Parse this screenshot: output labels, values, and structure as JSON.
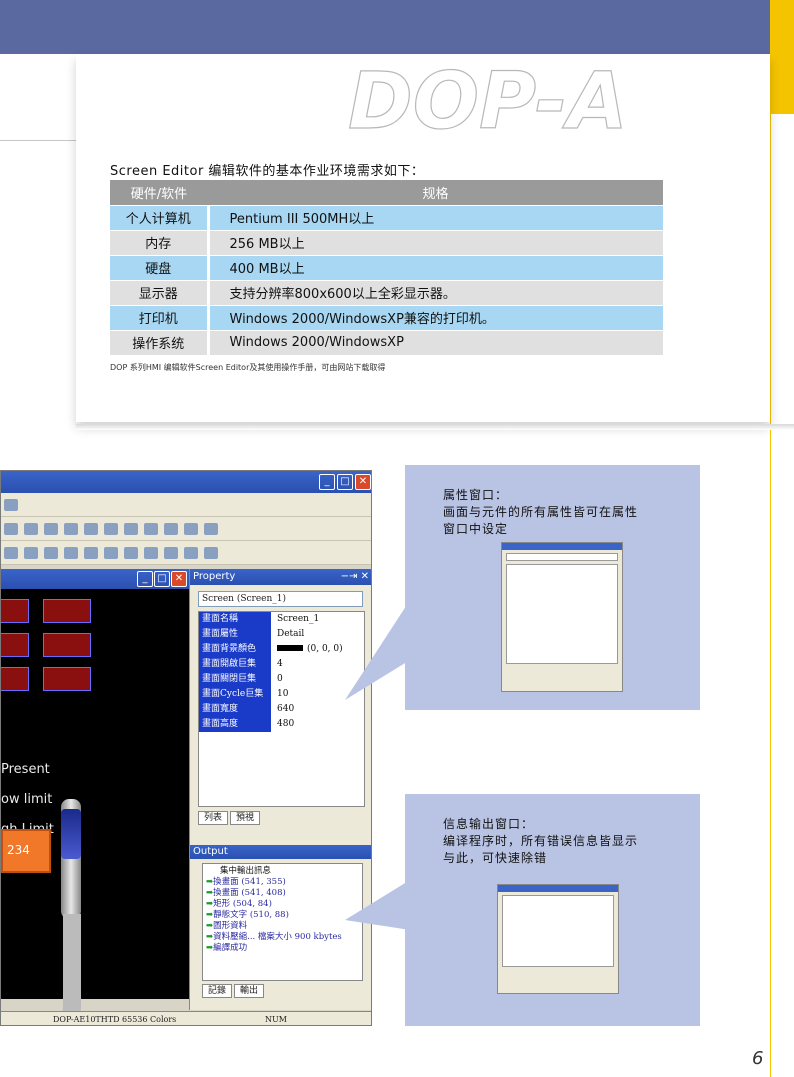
{
  "logo_text": "DOP-A",
  "intro": "Screen Editor 编辑软件的基本作业环境需求如下：",
  "table": {
    "headers": [
      "硬件/软件",
      "规格"
    ],
    "rows": [
      {
        "k": "个人计算机",
        "v": "Pentium III 500MH以上"
      },
      {
        "k": "内存",
        "v": "256 MB以上"
      },
      {
        "k": "硬盘",
        "v": "400 MB以上"
      },
      {
        "k": "显示器",
        "v": "支持分辨率800x600以上全彩显示器。"
      },
      {
        "k": "打印机",
        "v": "Windows 2000/WindowsXP兼容的打印机。"
      },
      {
        "k": "操作系统",
        "v": "Windows 2000/WindowsXP"
      }
    ]
  },
  "footnote": "DOP 系列HMI 编辑软件Screen Editor及其使用操作手册，可由网站下载取得",
  "screenshot": {
    "canvas_texts": [
      "Present",
      "ow limit",
      "gh Limit"
    ],
    "orange_value": "234",
    "property": {
      "title": "Property",
      "pin": "−⇥ ✕",
      "select": "Screen (Screen_1)",
      "rows": [
        {
          "k": "畫面名稱",
          "v": "Screen_1"
        },
        {
          "k": "畫面屬性",
          "v": "Detail"
        },
        {
          "k": "畫面背景顏色",
          "v": "(0, 0, 0)"
        },
        {
          "k": "畫面開啟巨集",
          "v": "4"
        },
        {
          "k": "畫面關閉巨集",
          "v": "0"
        },
        {
          "k": "畫面Cycle巨集",
          "v": "10"
        },
        {
          "k": "畫面寬度",
          "v": "640"
        },
        {
          "k": "畫面高度",
          "v": "480"
        }
      ],
      "tabs": [
        "列表",
        "預視"
      ]
    },
    "output": {
      "title": "Output",
      "header": "集中輸出訊息",
      "items": [
        "換畫面 (541, 355)",
        "換畫面 (541, 408)",
        "矩形 (504, 84)",
        "靜態文字 (510, 88)",
        "圖形資料",
        "資料壓縮... 檔案大小 900 kbytes",
        "編譯成功"
      ],
      "tabs": [
        "記錄",
        "輸出"
      ]
    },
    "status": {
      "model": "DOP-AE10THTD 65536 Colors",
      "num": "NUM"
    }
  },
  "callouts": [
    {
      "title": "属性窗口：",
      "body1": "画面与元件的所有属性皆可在属性",
      "body2": "窗口中设定"
    },
    {
      "title": "信息输出窗口：",
      "body1": "编译程序时，所有错误信息皆显示",
      "body2": "与此，可快速除错"
    }
  ],
  "page_number": "6",
  "colors": {
    "band": "#5a6aa0",
    "accent": "#f5c400",
    "row_blue": "#a7d7f2",
    "row_grey": "#e0e0e0",
    "header_grey": "#9a9a9a",
    "callout": "#b9c4e4"
  }
}
